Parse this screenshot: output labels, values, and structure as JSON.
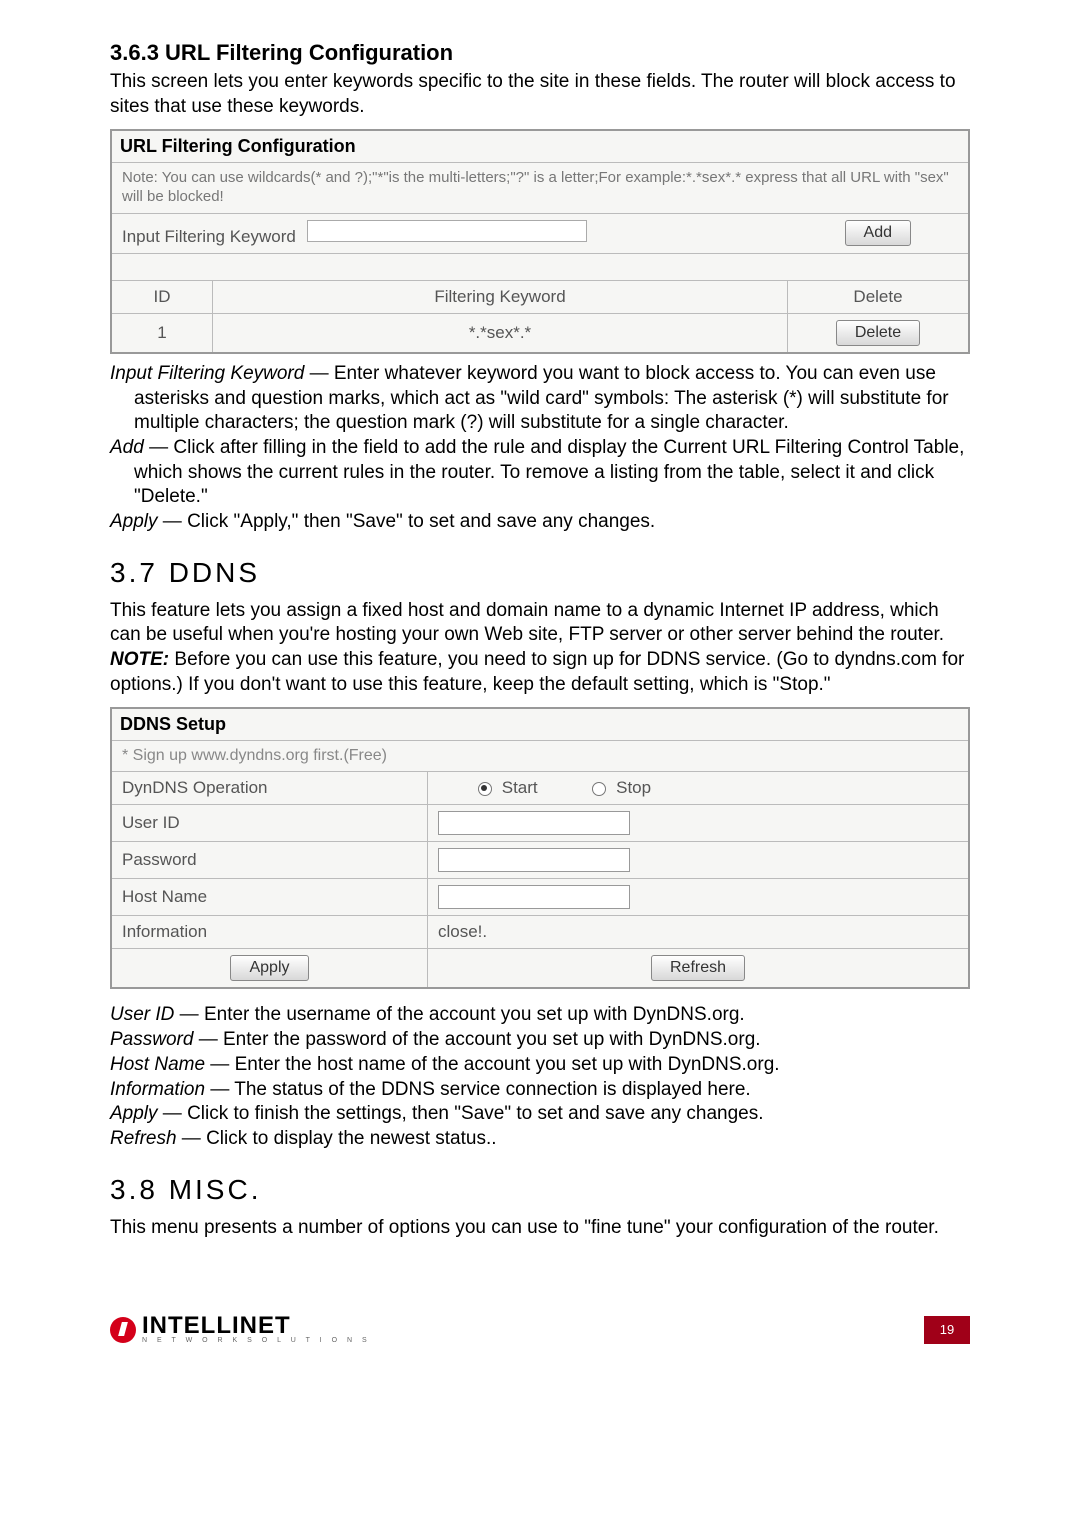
{
  "s363": {
    "heading": "3.6.3  URL Filtering Configuration",
    "intro": "This screen lets you enter keywords specific to the site in these fields. The router will block access to sites that use these keywords.",
    "panel_title": "URL Filtering Configuration",
    "note": "Note: You can use wildcards(* and ?);\"*\"is the multi-letters;\"?\" is a letter;For example:*.*sex*.* express that all URL with \"sex\" will be blocked!",
    "input_label": "Input Filtering Keyword",
    "add_btn": "Add",
    "col_id": "ID",
    "col_fk": "Filtering Keyword",
    "col_del": "Delete",
    "row_id": "1",
    "row_kw": "*.*sex*.*",
    "del_btn": "Delete",
    "desc_ifk_term": "Input Filtering Keyword",
    "desc_ifk": " — Enter whatever keyword you want to block access to. You can even use asterisks and question marks, which act as \"wild card\" symbols: The asterisk (*) will substitute for multiple characters; the question mark (?) will substitute for a single character.",
    "desc_add_term": "Add",
    "desc_add": " — Click after filling in the field to add the rule and display the Current URL Filtering Control Table, which shows the current rules in the router. To remove a listing from the table, select it and click \"Delete.\"",
    "desc_apply_term": "Apply",
    "desc_apply": " — Click \"Apply,\" then \"Save\" to set and save any changes."
  },
  "s37": {
    "heading": "3.7  DDNS",
    "intro1": "This feature lets you assign a fixed host and domain name to a dynamic Internet IP address, which can be useful when you're hosting your own Web site, FTP server or other server behind the router. ",
    "note_word": "NOTE:",
    "intro2": " Before you can use this feature, you need to sign up for DDNS service. (Go to dyndns.com for options.) If you don't want to use this feature, keep the default setting, which is \"Stop.\"",
    "panel_title": "DDNS Setup",
    "signup": "* Sign up www.dyndns.org first.(Free)",
    "row_op": "DynDNS Operation",
    "opt_start": "Start",
    "opt_stop": "Stop",
    "row_user": "User ID",
    "row_pass": "Password",
    "row_host": "Host Name",
    "row_info": "Information",
    "info_val": "close!.",
    "apply_btn": "Apply",
    "refresh_btn": "Refresh",
    "d_user_t": "User ID",
    "d_user": " — Enter the username of the account you set up with DynDNS.org.",
    "d_pass_t": "Password",
    "d_pass": " — Enter the password of the account you set up with DynDNS.org.",
    "d_host_t": "Host Name",
    "d_host": " — Enter the host name of the account you set up with DynDNS.org.",
    "d_info_t": "Information",
    "d_info": " — The status of the DDNS service connection is displayed here.",
    "d_apply_t": "Apply",
    "d_apply": " — Click to finish the settings, then \"Save\" to set and save any changes.",
    "d_refresh_t": "Refresh",
    "d_refresh": " — Click to display the newest status.."
  },
  "s38": {
    "heading": "3.8  Misc.",
    "intro": "This menu presents a number of options you can use to \"fine tune\" your configuration of the router."
  },
  "footer": {
    "logo_text": "INTELLINET",
    "logo_sub": "N E T W O R K   S O L U T I O N S",
    "page_num": "19"
  }
}
